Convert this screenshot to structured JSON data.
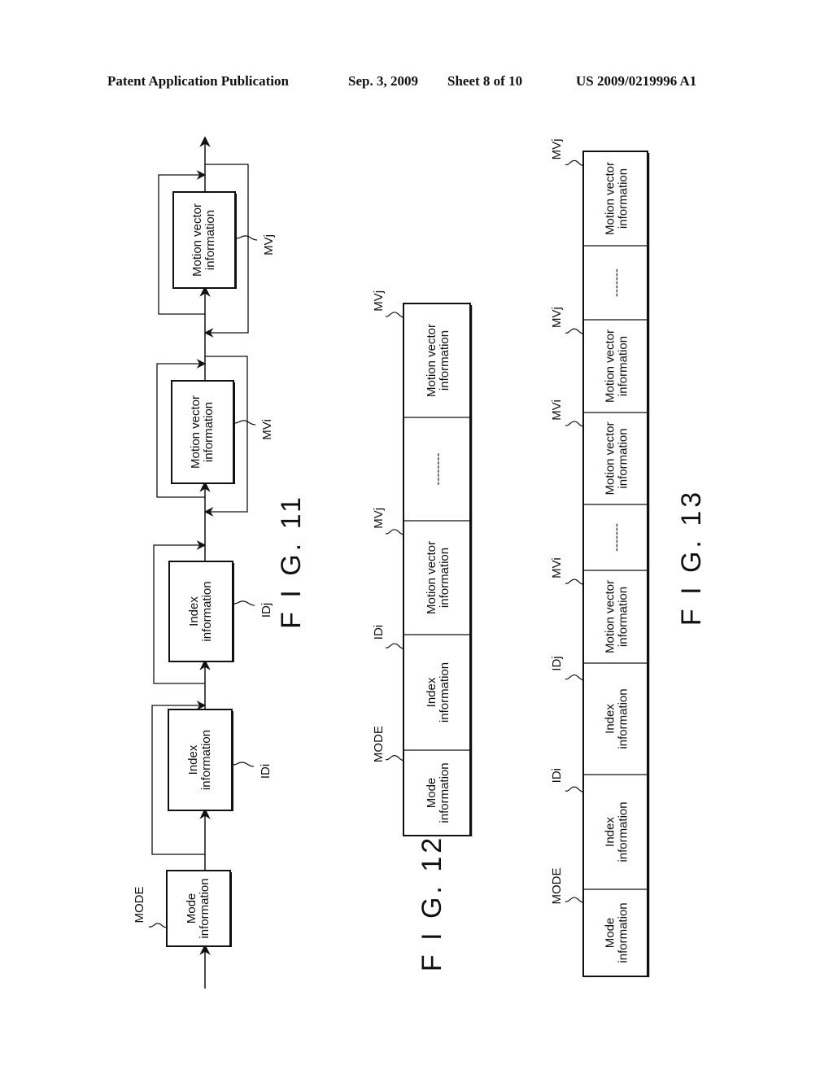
{
  "header": {
    "publication": "Patent Application Publication",
    "date": "Sep. 3, 2009",
    "sheet": "Sheet 8 of 10",
    "number": "US 2009/0219996 A1"
  },
  "fig11": {
    "caption": "F I G. 11",
    "blocks": [
      {
        "line1": "Mode",
        "line2": "information",
        "ref": "MODE"
      },
      {
        "line1": "Index",
        "line2": "information",
        "ref": "IDi"
      },
      {
        "line1": "Index",
        "line2": "information",
        "ref": "IDj"
      },
      {
        "line1": "Motion vector",
        "line2": "information",
        "ref": "MVi"
      },
      {
        "line1": "Motion vector",
        "line2": "information",
        "ref": "MVj"
      }
    ]
  },
  "fig12": {
    "caption": "F I G. 12",
    "cells": [
      {
        "line1": "Mode",
        "line2": "information",
        "ref": "MODE"
      },
      {
        "line1": "Index",
        "line2": "information",
        "ref": "IDi"
      },
      {
        "line1": "Motion vector",
        "line2": "information",
        "ref": "MVj"
      },
      {
        "line1": "--------",
        "line2": "",
        "ref": ""
      },
      {
        "line1": "Motion vector",
        "line2": "information",
        "ref": "MVj"
      }
    ]
  },
  "fig13": {
    "caption": "F I G. 13",
    "cells": [
      {
        "line1": "Mode",
        "line2": "information",
        "ref": "MODE"
      },
      {
        "line1": "Index",
        "line2": "information",
        "ref": "IDi"
      },
      {
        "line1": "Index",
        "line2": "information",
        "ref": "IDj"
      },
      {
        "line1": "Motion vector",
        "line2": "information",
        "ref": "MVi"
      },
      {
        "line1": "-------",
        "line2": "",
        "ref": ""
      },
      {
        "line1": "Motion vector",
        "line2": "information",
        "ref": "MVi"
      },
      {
        "line1": "Motion vector",
        "line2": "information",
        "ref": "MVj"
      },
      {
        "line1": "-------",
        "line2": "",
        "ref": ""
      },
      {
        "line1": "Motion vector",
        "line2": "information",
        "ref": "MVj"
      }
    ]
  }
}
